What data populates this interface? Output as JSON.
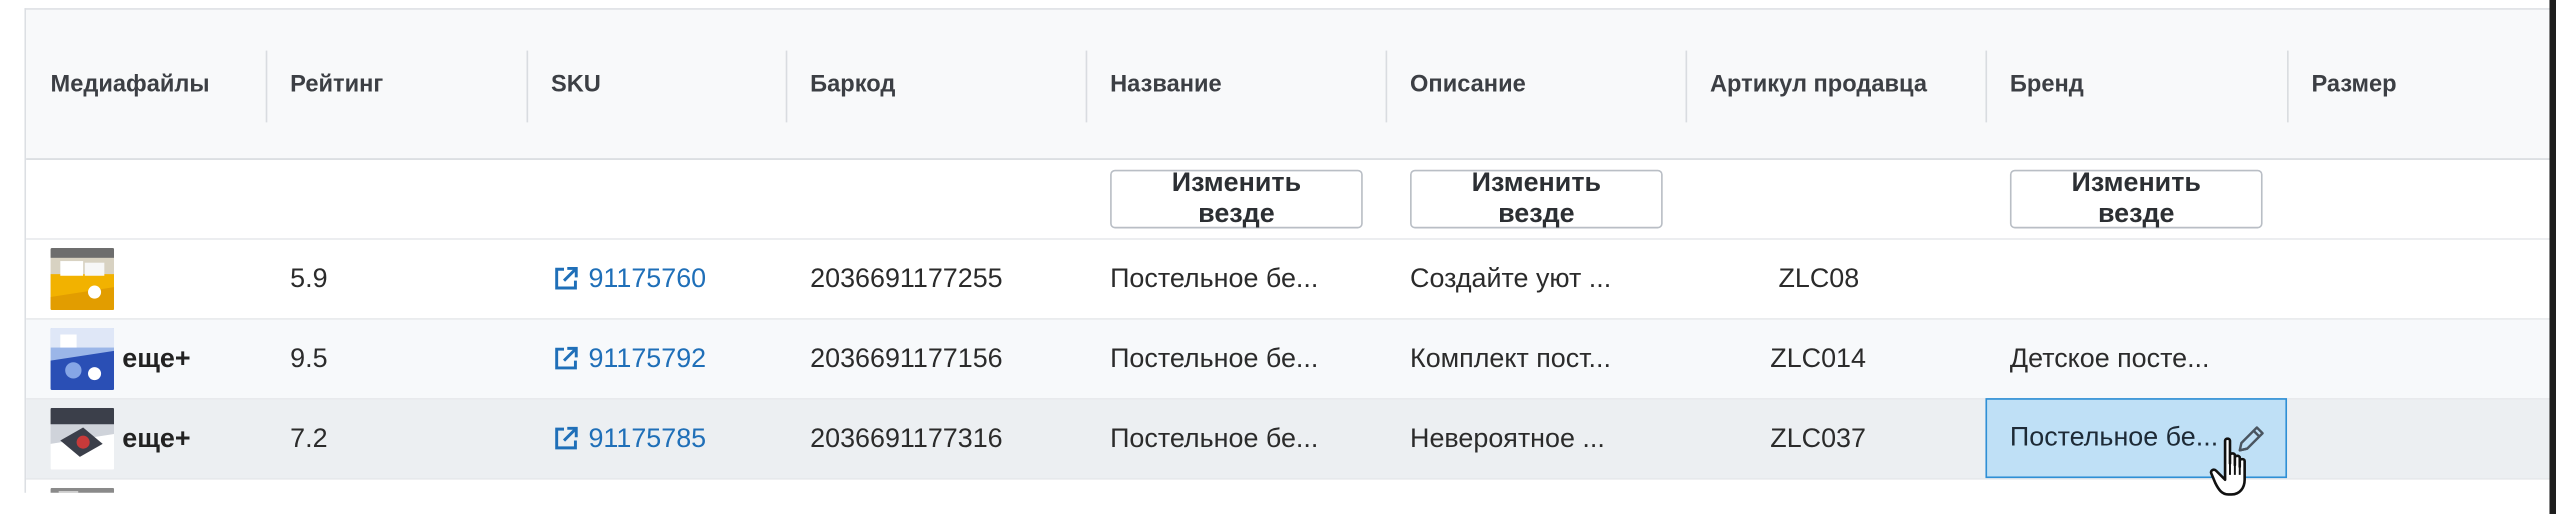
{
  "header": {
    "columns": [
      "Медиафайлы",
      "Рейтинг",
      "SKU",
      "Баркод",
      "Название",
      "Описание",
      "Артикул продавца",
      "Бренд",
      "Размер"
    ]
  },
  "filter_row": {
    "change_everywhere_label": "Изменить везде"
  },
  "rows": [
    {
      "media_more": "",
      "rating": "5.9",
      "sku": "91175760",
      "barcode": "2036691177255",
      "name": "Постельное бе...",
      "description": "Создайте уют ...",
      "seller_article": "ZLC08",
      "brand": "",
      "thumb_colors": [
        "#f2b200",
        "#ffffff",
        "#6d6d6d"
      ]
    },
    {
      "media_more": "еще+",
      "rating": "9.5",
      "sku": "91175792",
      "barcode": "2036691177156",
      "name": "Постельное бе...",
      "description": "Комплект пост...",
      "seller_article": "ZLC014",
      "brand": "Детское посте...",
      "thumb_colors": [
        "#2a4fb5",
        "#86a6e6",
        "#ffffff"
      ]
    },
    {
      "media_more": "еще+",
      "rating": "7.2",
      "sku": "91175785",
      "barcode": "2036691177316",
      "name": "Постельное бе...",
      "description": "Невероятное ...",
      "seller_article": "ZLC037",
      "brand": "Постельное бе...",
      "thumb_colors": [
        "#3b3f4a",
        "#ffffff",
        "#c83a3a"
      ]
    }
  ],
  "icons": {
    "external_link": "external-link-icon",
    "edit": "pencil-icon",
    "cursor": "hand-cursor-icon"
  },
  "colors": {
    "link": "#1f6fb8",
    "editing_cell_bg": "#bfe0f6",
    "editing_cell_border": "#2f8fd5",
    "header_bg": "#f8f9fa"
  }
}
